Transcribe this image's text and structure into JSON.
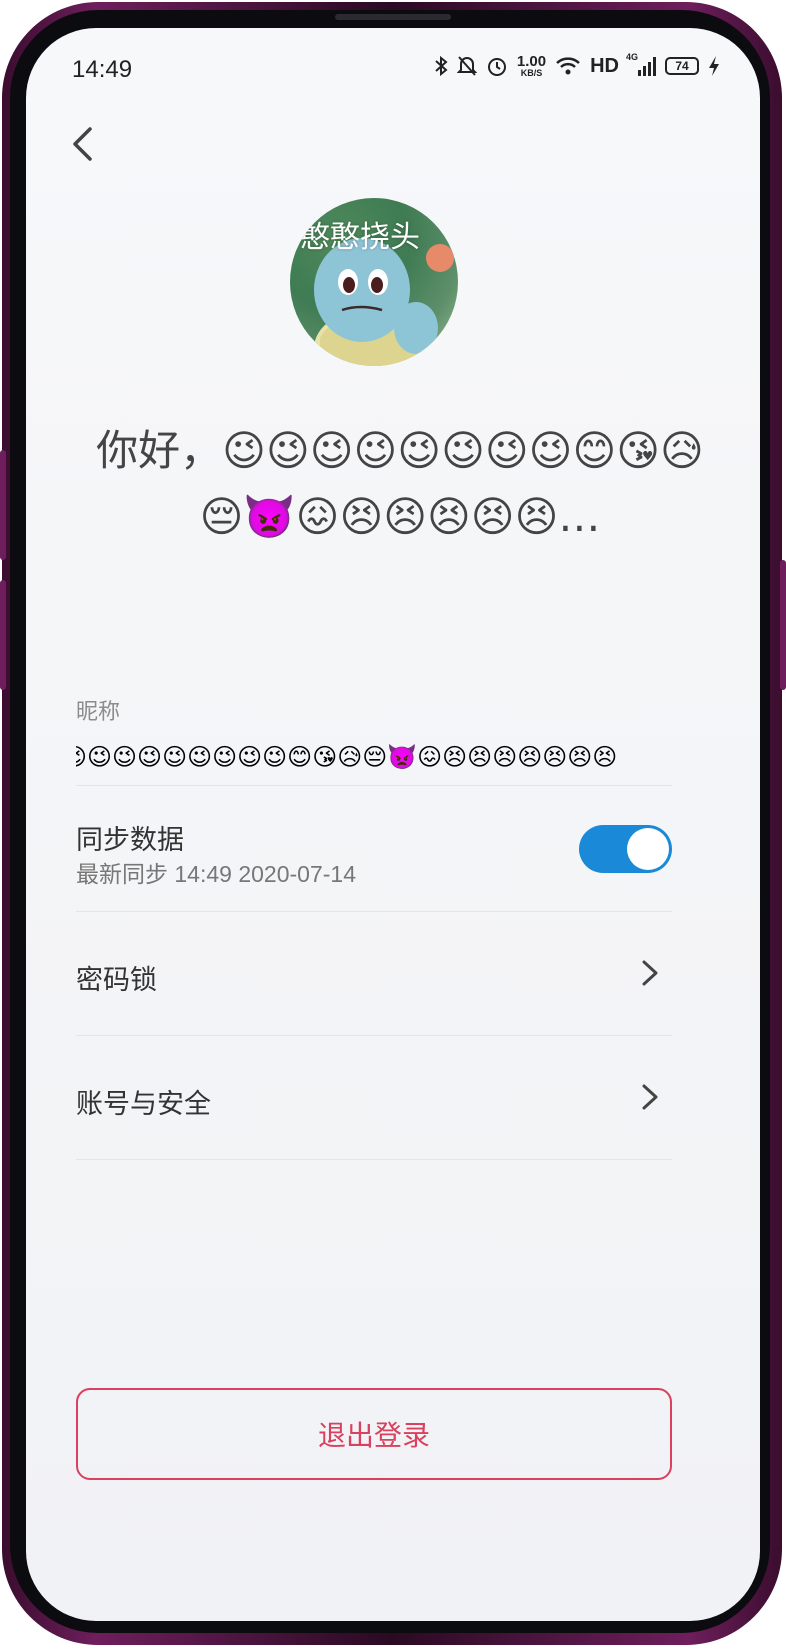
{
  "status_bar": {
    "time": "14:49",
    "speed_value": "1.00",
    "speed_unit": "KB/S",
    "hd": "HD",
    "network": "4G",
    "battery": "74",
    "icons": [
      "bluetooth-icon",
      "mute-icon",
      "alarm-icon",
      "wifi-icon",
      "signal-icon",
      "charging-icon"
    ]
  },
  "header": {
    "back_icon": "chevron-left-icon"
  },
  "profile": {
    "avatar_text": "憨憨挠头",
    "greeting": "你好，😉😉😉😉😉😉😉😉😊😘😥😔👿😖😣😣😣😣😣…"
  },
  "nickname": {
    "label": "昵称",
    "value": "😉😉😉😉😉😉😉😉😉😊😘😥😔👿😖😣😣😣😣😣😣😣"
  },
  "sync": {
    "title": "同步数据",
    "subtitle": "最新同步 14:49 2020-07-14",
    "enabled": true
  },
  "menu": [
    {
      "label": "密码锁",
      "icon": "chevron-right-icon"
    },
    {
      "label": "账号与安全",
      "icon": "chevron-right-icon"
    }
  ],
  "logout": {
    "label": "退出登录"
  },
  "colors": {
    "accent": "#1a8ad8",
    "danger": "#d9415f",
    "background": "#f3f4f7"
  }
}
